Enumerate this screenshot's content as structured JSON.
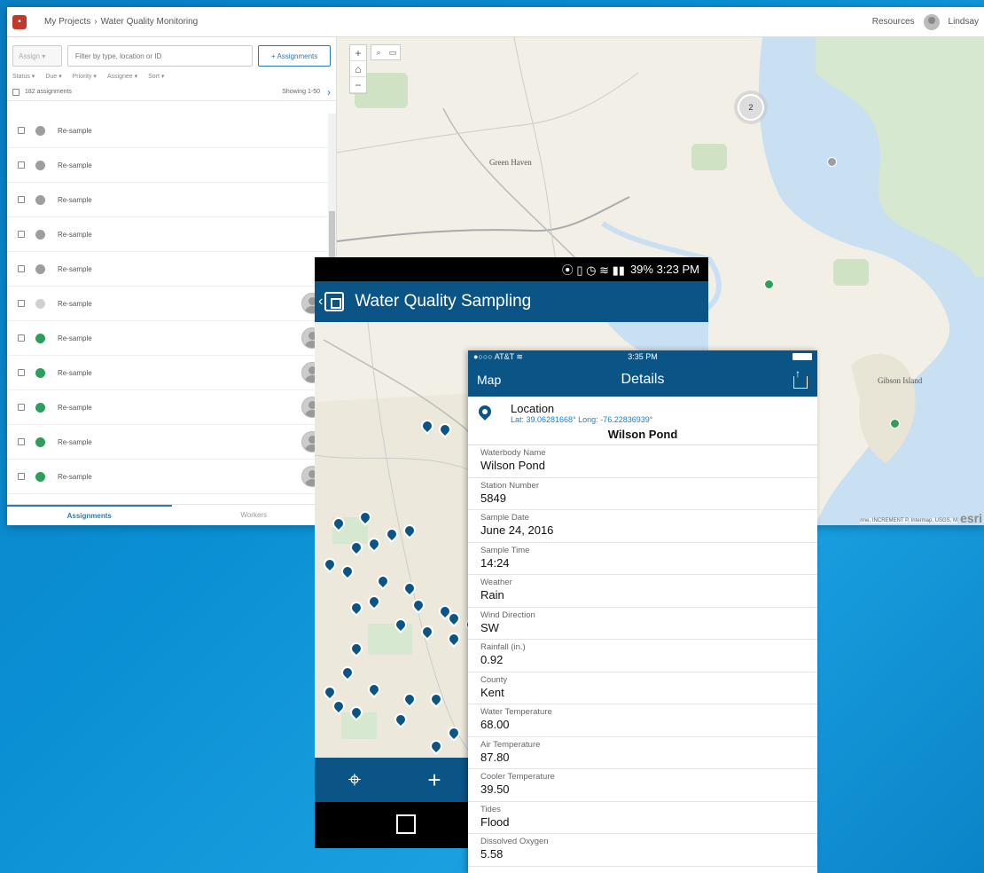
{
  "desktop": {
    "breadcrumb": {
      "project_root": "My Projects",
      "separator": "›",
      "current": "Water Quality Monitoring"
    },
    "header_right": {
      "resources": "Resources",
      "user": "Lindsay"
    },
    "toolbar": {
      "assign_label": "Assign",
      "filter_placeholder": "Filter by type, location or ID",
      "assignments_button": "+ Assignments"
    },
    "filters": [
      "Status ▾",
      "Due ▾",
      "Priority ▾",
      "Assignee ▾",
      "Sort ▾"
    ],
    "count_label": "182 assignments",
    "showing": "Showing 1-50",
    "next_icon": "›",
    "rows": [
      {
        "label": "Re-sample",
        "status_color": "#9e9e9e",
        "assigned": false
      },
      {
        "label": "Re-sample",
        "status_color": "#9e9e9e",
        "assigned": false
      },
      {
        "label": "Re-sample",
        "status_color": "#9e9e9e",
        "assigned": false
      },
      {
        "label": "Re-sample",
        "status_color": "#9e9e9e",
        "assigned": false
      },
      {
        "label": "Re-sample",
        "status_color": "#9e9e9e",
        "assigned": false
      },
      {
        "label": "Re-sample",
        "status_color": "#d0d0d0",
        "assigned": true
      },
      {
        "label": "Re-sample",
        "status_color": "#2e9e5b",
        "assigned": true
      },
      {
        "label": "Re-sample",
        "status_color": "#2e9e5b",
        "assigned": true
      },
      {
        "label": "Re-sample",
        "status_color": "#2e9e5b",
        "assigned": true
      },
      {
        "label": "Re-sample",
        "status_color": "#2e9e5b",
        "assigned": true
      },
      {
        "label": "Re-sample",
        "status_color": "#2e9e5b",
        "assigned": true
      }
    ],
    "tabs": [
      "Assignments",
      "Workers"
    ]
  },
  "map": {
    "zoom_in": "+",
    "zoom_out": "−",
    "home_icon": "⌂",
    "cluster_count": "2",
    "labels": [
      "Green Haven",
      "Gibson Island"
    ],
    "attribution": "rme, INCREMENT P, Intermap, USGS, M",
    "esri": "esri",
    "accent_point": "#2e9e5b",
    "gray_point": "#9e9e9e"
  },
  "android": {
    "status": "39%  3:23 PM",
    "status_icons": "⦿ ▯ ◷ ≋ ▮▮",
    "title": "Water Quality Sampling",
    "back_icon": "‹",
    "bar_color": "#0b5486",
    "bottom_icons": [
      "⌖",
      "+"
    ]
  },
  "ios": {
    "carrier": "●○○○ AT&T ≋",
    "time": "3:35 PM",
    "nav_back": "Map",
    "nav_title": "Details",
    "location_title": "Location",
    "location_coords": "Lat: 39.06281668° Long: -76.22836939°",
    "heading": "Wilson Pond",
    "fields": [
      {
        "label": "Waterbody Name",
        "value": "Wilson Pond"
      },
      {
        "label": "Station Number",
        "value": "5849"
      },
      {
        "label": "Sample Date",
        "value": "June 24, 2016"
      },
      {
        "label": "Sample Time",
        "value": "14:24"
      },
      {
        "label": "Weather",
        "value": "Rain"
      },
      {
        "label": "Wind Direction",
        "value": "SW"
      },
      {
        "label": "Rainfall (in.)",
        "value": "0.92"
      },
      {
        "label": "County",
        "value": "Kent"
      },
      {
        "label": "Water Temperature",
        "value": "68.00"
      },
      {
        "label": "Air Temperature",
        "value": "87.80"
      },
      {
        "label": "Cooler Temperature",
        "value": "39.50"
      },
      {
        "label": "Tides",
        "value": "Flood"
      },
      {
        "label": "Dissolved Oxygen",
        "value": "5.58"
      }
    ]
  }
}
